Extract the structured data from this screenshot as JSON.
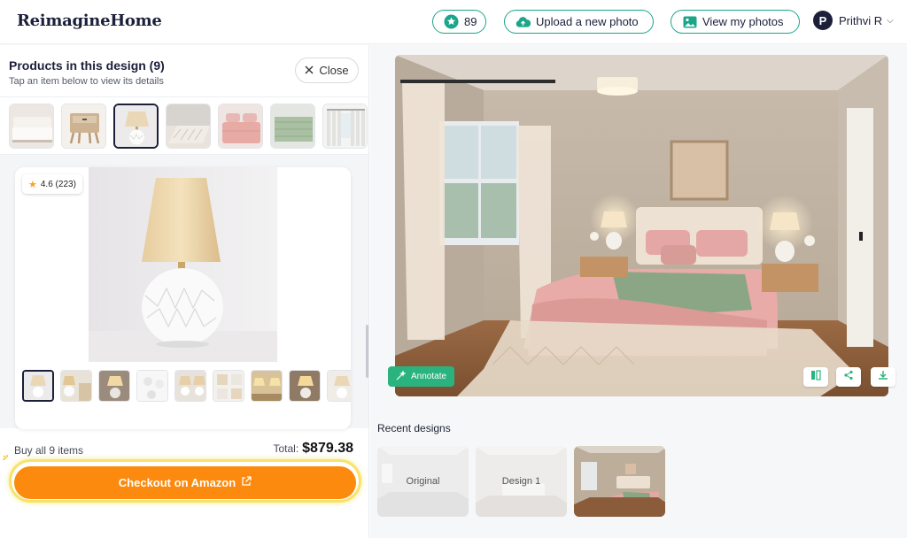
{
  "header": {
    "logo": "ReimagineHome",
    "credits": "89",
    "upload_label": "Upload a new photo",
    "view_photos_label": "View my photos",
    "user_initial": "P",
    "user_name": "Prithvi R"
  },
  "products_panel": {
    "title": "Products in this design (9)",
    "subtitle": "Tap an item below to view its details",
    "close_label": "Close",
    "product_thumbs": [
      "bed",
      "nightstand",
      "table-lamp",
      "rug",
      "bedding",
      "throw-blanket",
      "curtains"
    ],
    "selected_index": 2,
    "rating": "4.6 (223)",
    "gallery_count": 9,
    "buy_all_label": "Buy all 9 items",
    "total_label": "Total:",
    "total_value": "$879.38",
    "checkout_label": "Checkout on Amazon"
  },
  "design_panel": {
    "annotate_label": "Annotate",
    "recent_label": "Recent designs",
    "recent_designs": [
      "Original",
      "Design 1",
      ""
    ]
  },
  "colors": {
    "accent_teal": "#1ba58a",
    "checkout_orange": "#fb8a0e",
    "highlight_yellow": "#f7e36b",
    "annotate_green": "#2bb37f",
    "navy": "#1b1f3a"
  }
}
